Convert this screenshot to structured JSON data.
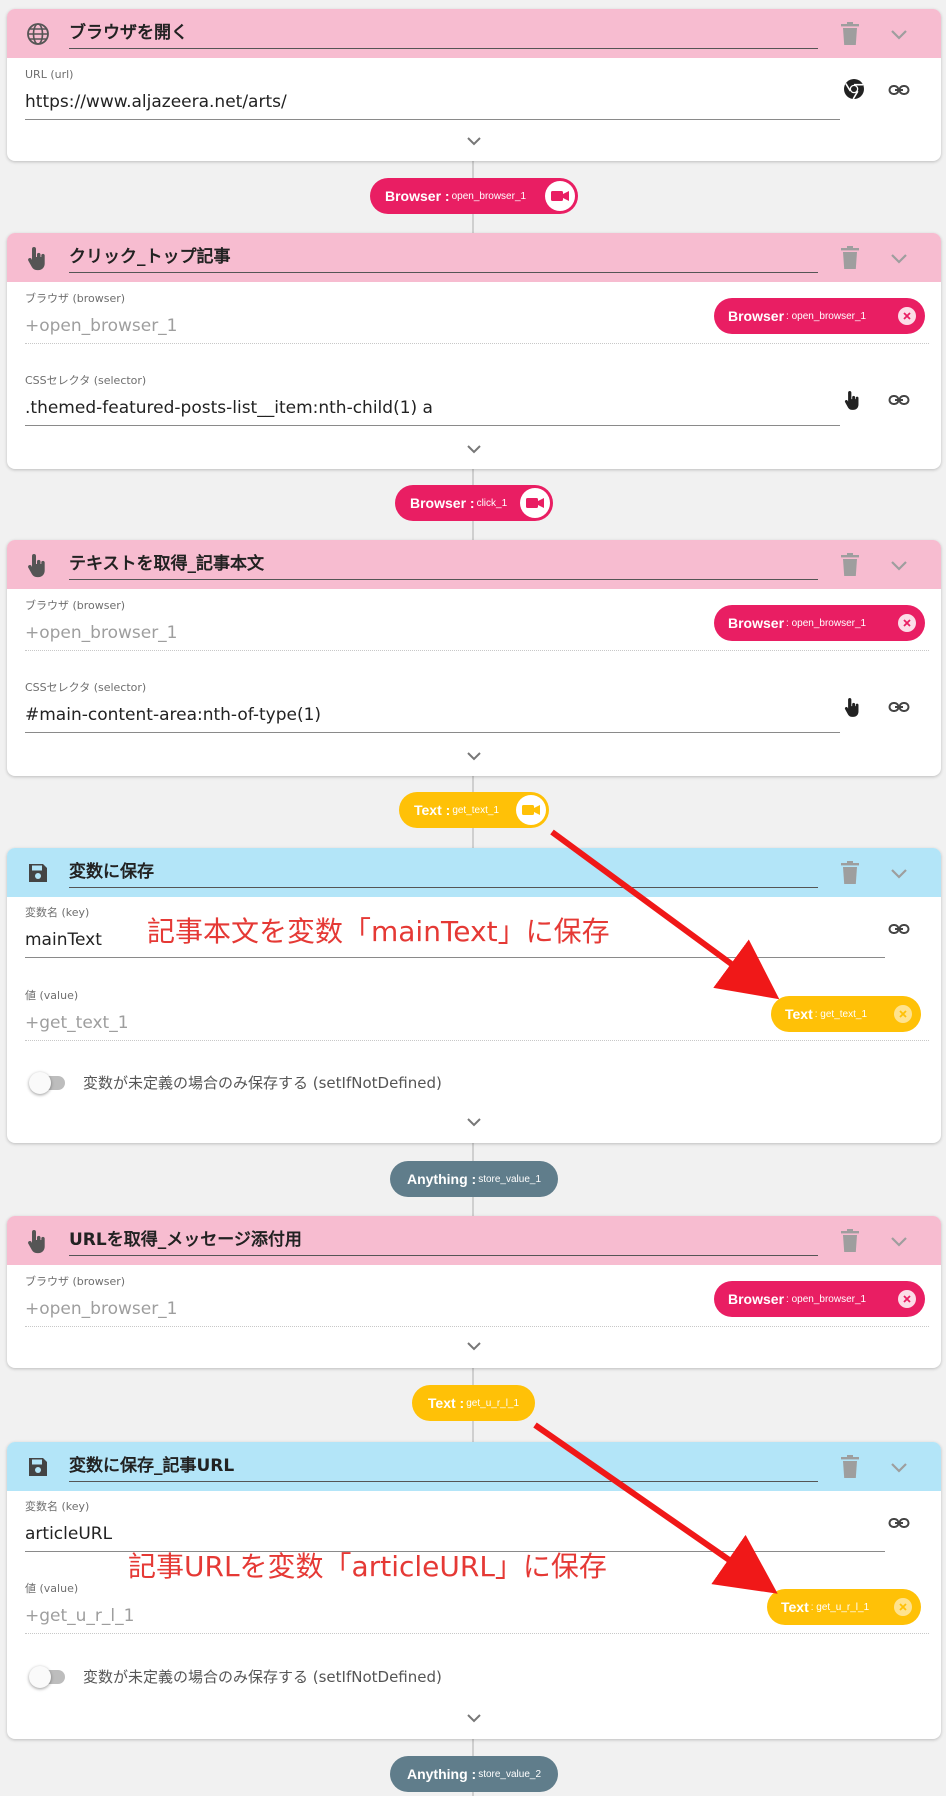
{
  "cards": [
    {
      "title": "ブラウザを開く",
      "fields": [
        {
          "label": "URL (url)",
          "value": "https://www.aljazeera.net/arts/"
        }
      ]
    },
    {
      "title": "クリック_トップ記事",
      "fields": [
        {
          "label": "ブラウザ (browser)",
          "value": "+open_browser_1",
          "chip_strong": "Browser",
          "chip_small": ": open_browser_1"
        },
        {
          "label": "CSSセレクタ (selector)",
          "value": ".themed-featured-posts-list__item:nth-child(1) a"
        }
      ]
    },
    {
      "title": "テキストを取得_記事本文",
      "fields": [
        {
          "label": "ブラウザ (browser)",
          "value": "+open_browser_1",
          "chip_strong": "Browser",
          "chip_small": ": open_browser_1"
        },
        {
          "label": "CSSセレクタ (selector)",
          "value": "#main-content-area:nth-of-type(1)"
        }
      ]
    },
    {
      "title": "変数に保存",
      "fields": [
        {
          "label": "変数名 (key)",
          "value": "mainText"
        },
        {
          "label": "値 (value)",
          "value": "+get_text_1",
          "chip_strong": "Text",
          "chip_small": ": get_text_1"
        }
      ],
      "toggle_label": "変数が未定義の場合のみ保存する (setIfNotDefined)"
    },
    {
      "title": "URLを取得_メッセージ添付用",
      "fields": [
        {
          "label": "ブラウザ (browser)",
          "value": "+open_browser_1",
          "chip_strong": "Browser",
          "chip_small": ": open_browser_1"
        }
      ]
    },
    {
      "title": "変数に保存_記事URL",
      "fields": [
        {
          "label": "変数名 (key)",
          "value": "articleURL"
        },
        {
          "label": "値 (value)",
          "value": "+get_u_r_l_1",
          "chip_strong": "Text",
          "chip_small": ": get_u_r_l_1"
        }
      ],
      "toggle_label": "変数が未定義の場合のみ保存する (setIfNotDefined)"
    }
  ],
  "outputs": [
    {
      "strong": "Browser :",
      "small": "open_browser_1"
    },
    {
      "strong": "Browser :",
      "small": "click_1"
    },
    {
      "strong": "Text :",
      "small": "get_text_1"
    },
    {
      "strong": "Anything :",
      "small": "store_value_1"
    },
    {
      "strong": "Text :",
      "small": "get_u_r_l_1"
    },
    {
      "strong": "Anything :",
      "small": "store_value_2"
    }
  ],
  "annotations": [
    "記事本文を変数「mainText」に保存",
    "記事URLを変数「articleURL」に保存"
  ],
  "colors": {
    "pink_header": "#f7bcd0",
    "blue_header": "#b3e5f8",
    "browser_chip": "#e91e63",
    "text_chip": "#ffc107",
    "anything_chip": "#607d8b",
    "annotation_red": "#e53935"
  },
  "icons": [
    "globe-icon",
    "hand-pointer-icon",
    "save-icon",
    "trash-icon",
    "chevron-down-icon",
    "chrome-icon",
    "link-icon",
    "video-camera-icon",
    "close-circle-icon"
  ]
}
